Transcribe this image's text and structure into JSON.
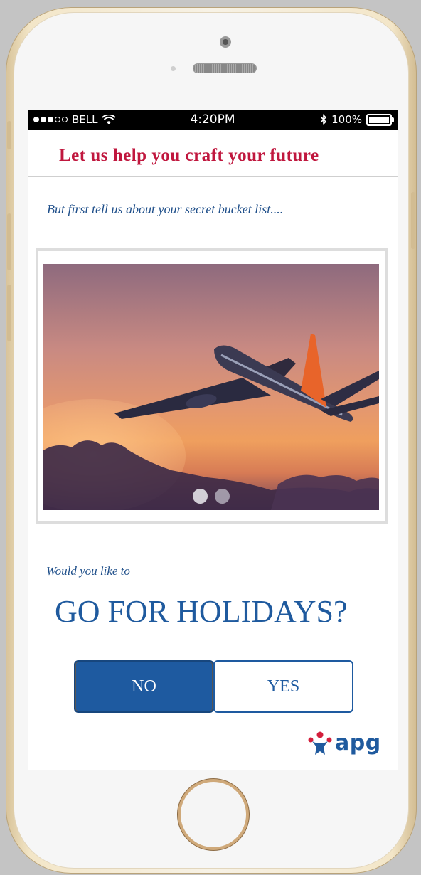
{
  "status_bar": {
    "carrier": "BELL",
    "time": "4:20PM",
    "battery": "100%",
    "icons": [
      "signal-dots-icon",
      "wifi-icon",
      "bluetooth-icon",
      "battery-icon"
    ]
  },
  "header": {
    "title": "Let us help you craft your future"
  },
  "intro": {
    "text": "But first tell us about your secret bucket list...."
  },
  "carousel": {
    "slide_image": "airplane-sunset-image",
    "slide_count": 2,
    "active_index": 0
  },
  "question": {
    "intro": "Would you like to",
    "text": "GO FOR HOLIDAYS?"
  },
  "buttons": {
    "no_label": "NO",
    "yes_label": "YES"
  },
  "logo": {
    "text": "apg",
    "icon": "apg-person-icon"
  },
  "colors": {
    "header_red": "#c0173e",
    "brand_blue": "#1e5aa0",
    "logo_red": "#d31f3c"
  }
}
